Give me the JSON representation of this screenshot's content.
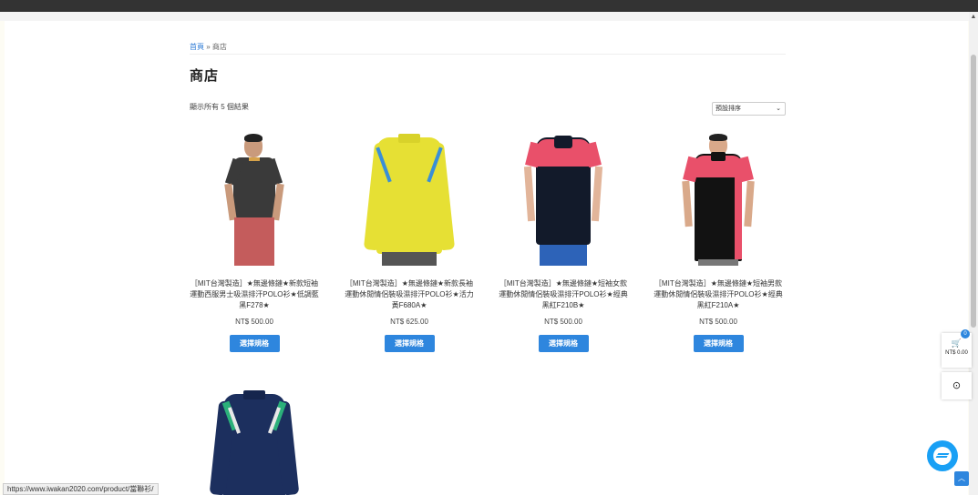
{
  "breadcrumb": {
    "home": "首頁",
    "separator": "»",
    "current": "商店"
  },
  "page_title": "商店",
  "result_count": "顯示所有 5 個結果",
  "sort": {
    "selected": "預設排序"
  },
  "products": [
    {
      "name": "［MIT台灣製造］★無邊條鏈★新款短袖運動西服男士吸濕排汗POLO衫★低調藍黑F278★",
      "price": "NT$ 500.00",
      "button": "選擇規格"
    },
    {
      "name": "［MIT台灣製造］★無邊條鏈★新款長袖運動休閒情侶裝吸濕排汗POLO衫★活力黃F680A★",
      "price": "NT$ 625.00",
      "button": "選擇規格"
    },
    {
      "name": "［MIT台灣製造］★無邊條鏈★短袖女款運動休閒情侶裝吸濕排汗POLO衫★經典黑紅F210B★",
      "price": "NT$ 500.00",
      "button": "選擇規格"
    },
    {
      "name": "［MIT台灣製造］★無邊條鏈★短袖男款運動休閒情侶裝吸濕排汗POLO衫★經典黑紅F210A★",
      "price": "NT$ 500.00",
      "button": "選擇規格"
    }
  ],
  "cart": {
    "count": "0",
    "total": "NT$ 0.00"
  },
  "status_url": "https://www.iwakan2020.com/product/當聯衫/",
  "colors": {
    "accent": "#2e86de",
    "messenger": "#19a0f5"
  }
}
